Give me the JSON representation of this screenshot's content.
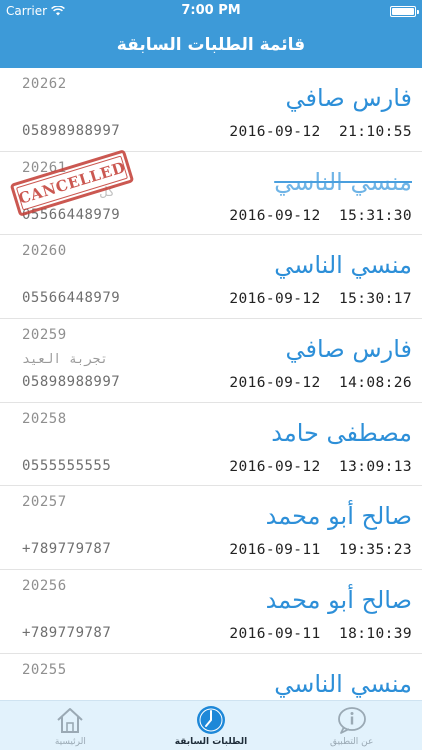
{
  "status_bar": {
    "carrier": "Carrier",
    "time": "7:00 PM"
  },
  "header": {
    "title": "قائمة الطلبات السابقة"
  },
  "orders": [
    {
      "id": "20262",
      "name": "فارس صافي",
      "note": "",
      "phone": "05898988997",
      "datetime": "2016-09-12  21:10:55",
      "cancelled": false
    },
    {
      "id": "20261",
      "name": "منسي الناسي",
      "note": "كل",
      "phone": "05566448979",
      "datetime": "2016-09-12  15:31:30",
      "cancelled": true,
      "stamp": "CANCELLED"
    },
    {
      "id": "20260",
      "name": "منسي الناسي",
      "note": "",
      "phone": "05566448979",
      "datetime": "2016-09-12  15:30:17",
      "cancelled": false
    },
    {
      "id": "20259",
      "name": "فارس صافي",
      "note": "تجربة العيد",
      "phone": "05898988997",
      "datetime": "2016-09-12  14:08:26",
      "cancelled": false
    },
    {
      "id": "20258",
      "name": "مصطفى حامد",
      "note": "",
      "phone": "0555555555",
      "datetime": "2016-09-12  13:09:13",
      "cancelled": false
    },
    {
      "id": "20257",
      "name": "صالح أبو محمد",
      "note": "",
      "phone": "+789779787",
      "datetime": "2016-09-11  19:35:23",
      "cancelled": false
    },
    {
      "id": "20256",
      "name": "صالح أبو محمد",
      "note": "",
      "phone": "+789779787",
      "datetime": "2016-09-11  18:10:39",
      "cancelled": false
    },
    {
      "id": "20255",
      "name": "منسي الناسي",
      "note": "",
      "phone": "",
      "datetime": "",
      "cancelled": false
    }
  ],
  "tab_bar": {
    "tabs": [
      {
        "label": "الرئيسية",
        "icon": "home-icon",
        "active": false
      },
      {
        "label": "الطلبات السابقة",
        "icon": "clock-icon",
        "active": true
      },
      {
        "label": "عن التطبيق",
        "icon": "info-icon",
        "active": false
      }
    ]
  },
  "colors": {
    "brand": "#3d9ad8",
    "name_text": "#2d8fd8",
    "stamp": "#c4413a",
    "tab_bar_bg": "#e2f2fc",
    "active_tab_icon": "#1e88d8",
    "inactive_tab_icon": "#9aa9b4"
  }
}
